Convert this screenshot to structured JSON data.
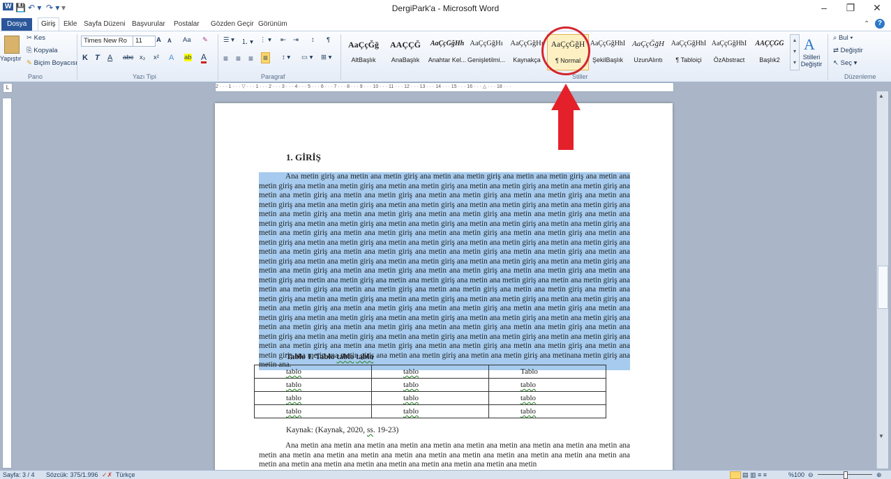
{
  "window": {
    "title": "DergiPark'a  -  Microsoft Word",
    "minimize": "–",
    "restore": "❐",
    "close": "✕"
  },
  "qat": {
    "app_icon": "W",
    "save": "💾",
    "undo": "↶ ▾",
    "redo": "↷ ▾",
    "more": "▾"
  },
  "tabs": [
    "Dosya",
    "Giriş",
    "Ekle",
    "Sayfa Düzeni",
    "Başvurular",
    "Postalar",
    "Gözden Geçir",
    "Görünüm"
  ],
  "help": {
    "collapse": "⌃",
    "help": "?"
  },
  "ribbon": {
    "pano": {
      "paste": "Yapıştır",
      "cut": "Kes",
      "copy": "Kopyala",
      "format_painter": "Biçim Boyacısı",
      "label": "Pano"
    },
    "font": {
      "family": "Times New Ro",
      "size": "11",
      "grow": "A",
      "shrink": "A",
      "case": "Aa",
      "clear": "✎",
      "bold": "K",
      "italic": "T",
      "underline": "A",
      "strike": "abc",
      "subscript": "x₂",
      "superscript": "x²",
      "effects": "A",
      "highlight": "ab",
      "color": "A",
      "label": "Yazı Tipi"
    },
    "paragraph": {
      "bullets": "☰ ▾",
      "numbering": "⒈ ▾",
      "multilevel": "⋮ ▾",
      "outdent": "⇤",
      "indent": "⇥",
      "sort": "↕",
      "pilcrow": "¶",
      "align_left": "≡",
      "align_center": "≡",
      "align_right": "≡",
      "justify": "≡",
      "spacing": "↕ ▾",
      "shading": "▭ ▾",
      "borders": "⊞ ▾",
      "label": "Paragraf"
    },
    "styles": {
      "items": [
        {
          "preview": "AaÇçĞğ",
          "name": "AltBaşlık"
        },
        {
          "preview": "AAÇÇĞ",
          "name": "AnaBaşlık"
        },
        {
          "preview": "AaÇçĞğHh",
          "name": "Anahtar Kel..."
        },
        {
          "preview": "AaÇçĞğHı",
          "name": "Genişletilmi..."
        },
        {
          "preview": "AaÇçĞğHı",
          "name": "Kaynakça"
        },
        {
          "preview": "AaÇçĞğH",
          "name": "¶ Normal"
        },
        {
          "preview": "AaÇçĞğHhI",
          "name": "ŞekilBaşlık"
        },
        {
          "preview": "AaÇçĞğH",
          "name": "UzunAlıntı"
        },
        {
          "preview": "AaÇçĞğHhI",
          "name": "¶ Tabloiçi"
        },
        {
          "preview": "AaÇçĞğHhI",
          "name": "ÖzAbstract"
        },
        {
          "preview": "AAÇÇĞĞ",
          "name": "Başlık2"
        }
      ],
      "change_styles": "Stilleri Değiştir",
      "label": "Stiller"
    },
    "editing": {
      "find": "Bul",
      "replace": "Değiştir",
      "select": "Seç",
      "label": "Düzenleme"
    }
  },
  "ruler": {
    "marks": "2 · · · 1 · · · ▽ · · · 1 · · · 2 · · · 3 · · · 4 · · · 5 · · · 6 · · · 7 · · · 8 · · · 9 · · · 10 · · · 11 · · · 12 · · · 13 · · · 14 · · · 15 · · · 16 · · · △ · · · 18 · · ·"
  },
  "document": {
    "heading": "1. GİRİŞ",
    "paragraph": "Ana metin giriş ana metin ana metin giriş ana metin ana metin giriş ana metin ana metin giriş ana metin ana metin giriş ana metin ana metin giriş ana metin ana metin giriş ana metin ana metin giriş ana metin ana metin giriş ana metin ana metin giriş ana metin ana metin giriş ana metin ana metin giriş ana metin ana metin giriş ana metin ana metin giriş ana metin ana metin giriş ana metin ana metin giriş ana metin ana metin giriş ana metin ana metin giriş ana metin ana metin giriş ana metin ana metin giriş ana metin ana metin giriş ana metin ana metin giriş ana metin ana metin giriş ana metin ana metin giriş ana metin ana metin giriş ana metin ana metin giriş ana metin ana metin giriş ana metin ana metin giriş ana metin ana metin giriş ana metin ana metin giriş ana metin ana metin giriş ana metin ana metin giriş ana metin ana metin giriş ana metin ana metin giriş ana metin ana metin giriş ana metin ana metin giriş ana metin ana metin giriş ana metin ana metin giriş ana metin ana metin giriş ana metin ana metin giriş ana metin ana metin giriş ana metin ana metin giriş ana metin ana metin giriş ana metin ana metin giriş ana metin ana metin giriş ana metin ana metin giriş ana metin ana metin giriş ana metin ana metin giriş ana metin ana metin giriş ana metin ana metin giriş ana metin ana metin giriş ana metin ana metin giriş ana metin ana metin giriş ana metin ana metin giriş ana metin ana metin giriş ana metin ana metin giriş ana metin ana metin giriş ana metin ana metin giriş ana metin ana metin giriş ana metin ana metin giriş ana metin ana metin giriş ana metin ana metin giriş ana metin ana metin giriş ana metin ana metin giriş ana metin ana metin giriş ana metin ana metin giriş ana metin ana metin giriş ana metin ana metin giriş ana metin ana metin giriş ana metin ana metin giriş ana metin ana metin giriş ana metin ana metin giriş ana metin ana metin giriş ana metin ana metin giriş ana metin ana metin giriş ana metin ana metin giriş ana metin ana metin giriş ana metin ana metin giriş ana metin ana metin giriş ana metin ana metin giriş ana metin ana metin giriş ana metin ana metin giriş ana metin ana metin giriş ana metin ana metin giriş ana metin ana metin giriş ana metin ana metin giriş ana metin ana metin giriş ana metin ana metin giriş ana metin ana metin giriş ana metinana metin giriş ana metin ana.",
    "table_caption": {
      "prefix": "Tablo 1. Tablo ",
      "wavy1": "tablo",
      "sp": " ",
      "wavy2": "tablo"
    },
    "table": [
      [
        "tablo",
        "tablo",
        "Tablo"
      ],
      [
        "tablo",
        "tablo",
        "tablo"
      ],
      [
        "tablo",
        "tablo",
        "tablo"
      ],
      [
        "tablo",
        "tablo",
        "tablo"
      ]
    ],
    "source": {
      "prefix": "Kaynak: (Kaynak, 2020, ",
      "wavy": "ss",
      "suffix": ". 19-23)"
    },
    "paragraph2": "Ana metin ana metin ana metin ana metin ana metin ana metin ana metin ana metin ana metin ana metin ana metin ana metin ana metin ana metin ana metin ana metin ana metin ana metin ana metin ana metin ana metin ana metin ana metin ana metin ana metin ana metin ana metin ana metin ana metin ana metin"
  },
  "statusbar": {
    "page": "Sayfa: 3 / 4",
    "words": "Sözcük: 375/1.996",
    "language": "Türkçe",
    "zoom": "%100"
  }
}
